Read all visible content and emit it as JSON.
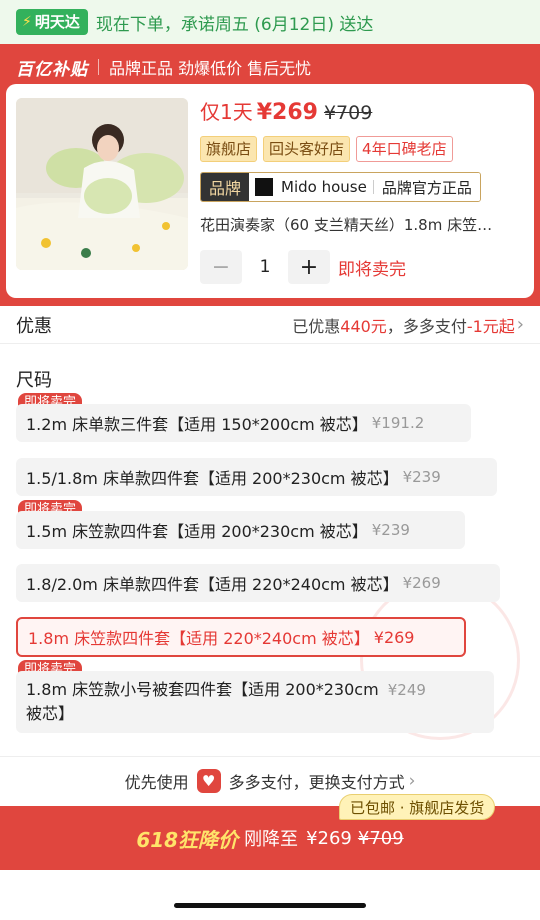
{
  "delivery": {
    "badge": "明天达",
    "text": "现在下单，承诺周五 (6月12日) 送达",
    "color": "#2e9a4f"
  },
  "subsidy": {
    "logo": "百亿补贴",
    "slogan": "品牌正品 劲爆低价 售后无忧",
    "color": "#e0463e"
  },
  "product": {
    "price_tag": "仅1天",
    "price": "¥269",
    "original_price": "¥709",
    "tags": [
      "旗舰店",
      "回头客好店",
      "4年口碑老店"
    ],
    "brand_label": "品牌",
    "brand_name": "Mido house",
    "brand_official": "品牌官方正品",
    "title": "花田演奏家（60 支兰精天丝）1.8m 床笠…",
    "quantity": "1",
    "minus": "−",
    "plus": "+",
    "sold_out_text": "即将卖完"
  },
  "discount": {
    "label": "优惠",
    "prefix": "已优惠",
    "amount": "440元",
    "middle": "，多多支付",
    "extra": "-1元起"
  },
  "size": {
    "label": "尺码",
    "sold_out_badge": "即将卖完",
    "options": [
      {
        "name": "1.2m 床单款三件套【适用 150*200cm 被芯】",
        "price": "¥191.2",
        "sold_out": true,
        "selected": false
      },
      {
        "name": "1.5/1.8m 床单款四件套【适用 200*230cm 被芯】",
        "price": "¥239",
        "sold_out": false,
        "selected": false
      },
      {
        "name": "1.5m 床笠款四件套【适用 200*230cm 被芯】",
        "price": "¥239",
        "sold_out": true,
        "selected": false
      },
      {
        "name": "1.8/2.0m 床单款四件套【适用 220*240cm 被芯】",
        "price": "¥269",
        "sold_out": false,
        "selected": false
      },
      {
        "name": "1.8m 床笠款四件套【适用 220*240cm 被芯】",
        "price": "¥269",
        "sold_out": false,
        "selected": true
      },
      {
        "name_line1": "1.8m 床笠款小号被套四件套【适用 200*230cm",
        "name_line2": "被芯】",
        "price": "¥249",
        "sold_out": true,
        "selected": false
      }
    ]
  },
  "payment": {
    "prefix": "优先使用",
    "method": "多多支付，更换支付方式"
  },
  "bottom": {
    "badge": "已包邮 · 旗舰店发货",
    "promo": "618狂降价",
    "drop_text": "刚降至",
    "price": "¥269",
    "original_price": "¥709"
  }
}
